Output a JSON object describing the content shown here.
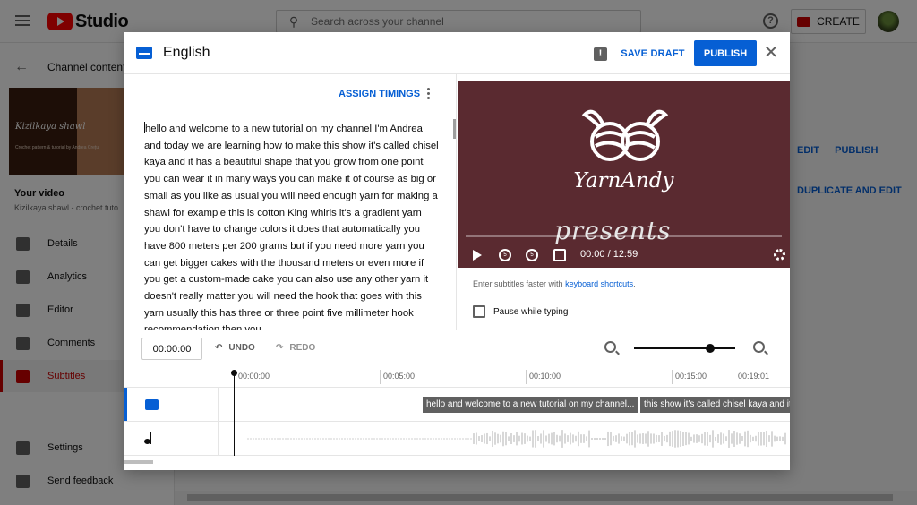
{
  "topbar": {
    "logo_text": "Studio",
    "search_placeholder": "Search across your channel",
    "create_label": "CREATE"
  },
  "sidebar": {
    "back_label": "Channel content",
    "thumb_title": "Kizilkaya shawl",
    "thumb_sub": "Crochet pattern & tutorial by Andrea Crețu",
    "your_video": "Your video",
    "video_name": "Kizilkaya shawl - crochet tuto",
    "items": [
      {
        "label": "Details",
        "icon": "pencil-icon"
      },
      {
        "label": "Analytics",
        "icon": "bar-chart-icon"
      },
      {
        "label": "Editor",
        "icon": "clapper-icon"
      },
      {
        "label": "Comments",
        "icon": "comment-icon"
      },
      {
        "label": "Subtitles",
        "icon": "subtitles-icon",
        "active": true
      },
      {
        "label": "Settings",
        "icon": "gear-icon"
      },
      {
        "label": "Send feedback",
        "icon": "feedback-icon"
      }
    ]
  },
  "background_actions": {
    "edit": "EDIT",
    "publish": "PUBLISH",
    "duplicate": "DUPLICATE AND EDIT"
  },
  "dialog": {
    "title": "English",
    "save_draft": "SAVE DRAFT",
    "publish": "PUBLISH",
    "assign_timings": "ASSIGN TIMINGS",
    "transcript": "hello and welcome to a new tutorial on my channel I'm Andrea and today we are learning how to make this show it's called chisel kaya and it has a beautiful shape that you grow from one point you can wear it in many ways you can make it of course as big or small as you like as usual you will need enough yarn for making a shawl for example this is cotton King whirls it's a gradient yarn you don't have to change colors it does that automatically you have 800 meters per 200 grams but if you need more yarn you can get bigger cakes with the thousand meters or even more if you get a custom-made cake you can also use any other yarn it doesn't really matter you will need the hook that goes with this yarn usually this has three or three point five millimeter hook recommendation then you",
    "video": {
      "brand": "YarnAndy",
      "overlay_text": "presents",
      "time": "00:00 / 12:59",
      "bg_color": "#5a2a30"
    },
    "shortcuts_text": "Enter subtitles faster with",
    "shortcuts_link": "keyboard shortcuts",
    "shortcuts_end": ".",
    "pause_label": "Pause while typing",
    "timecode": "00:00:00",
    "undo": "UNDO",
    "redo": "REDO",
    "zoom_level": 0.8,
    "ruler": [
      "00:00:00",
      "00:05:00",
      "00:10:00",
      "00:15:00",
      "00:19:01"
    ],
    "cues": [
      "hello and welcome to a new tutorial on my channel...",
      "this show it's called chisel kaya and it"
    ]
  },
  "colors": {
    "accent": "#065fd4",
    "brand_red": "#ff0000",
    "active_red": "#cc0000"
  }
}
